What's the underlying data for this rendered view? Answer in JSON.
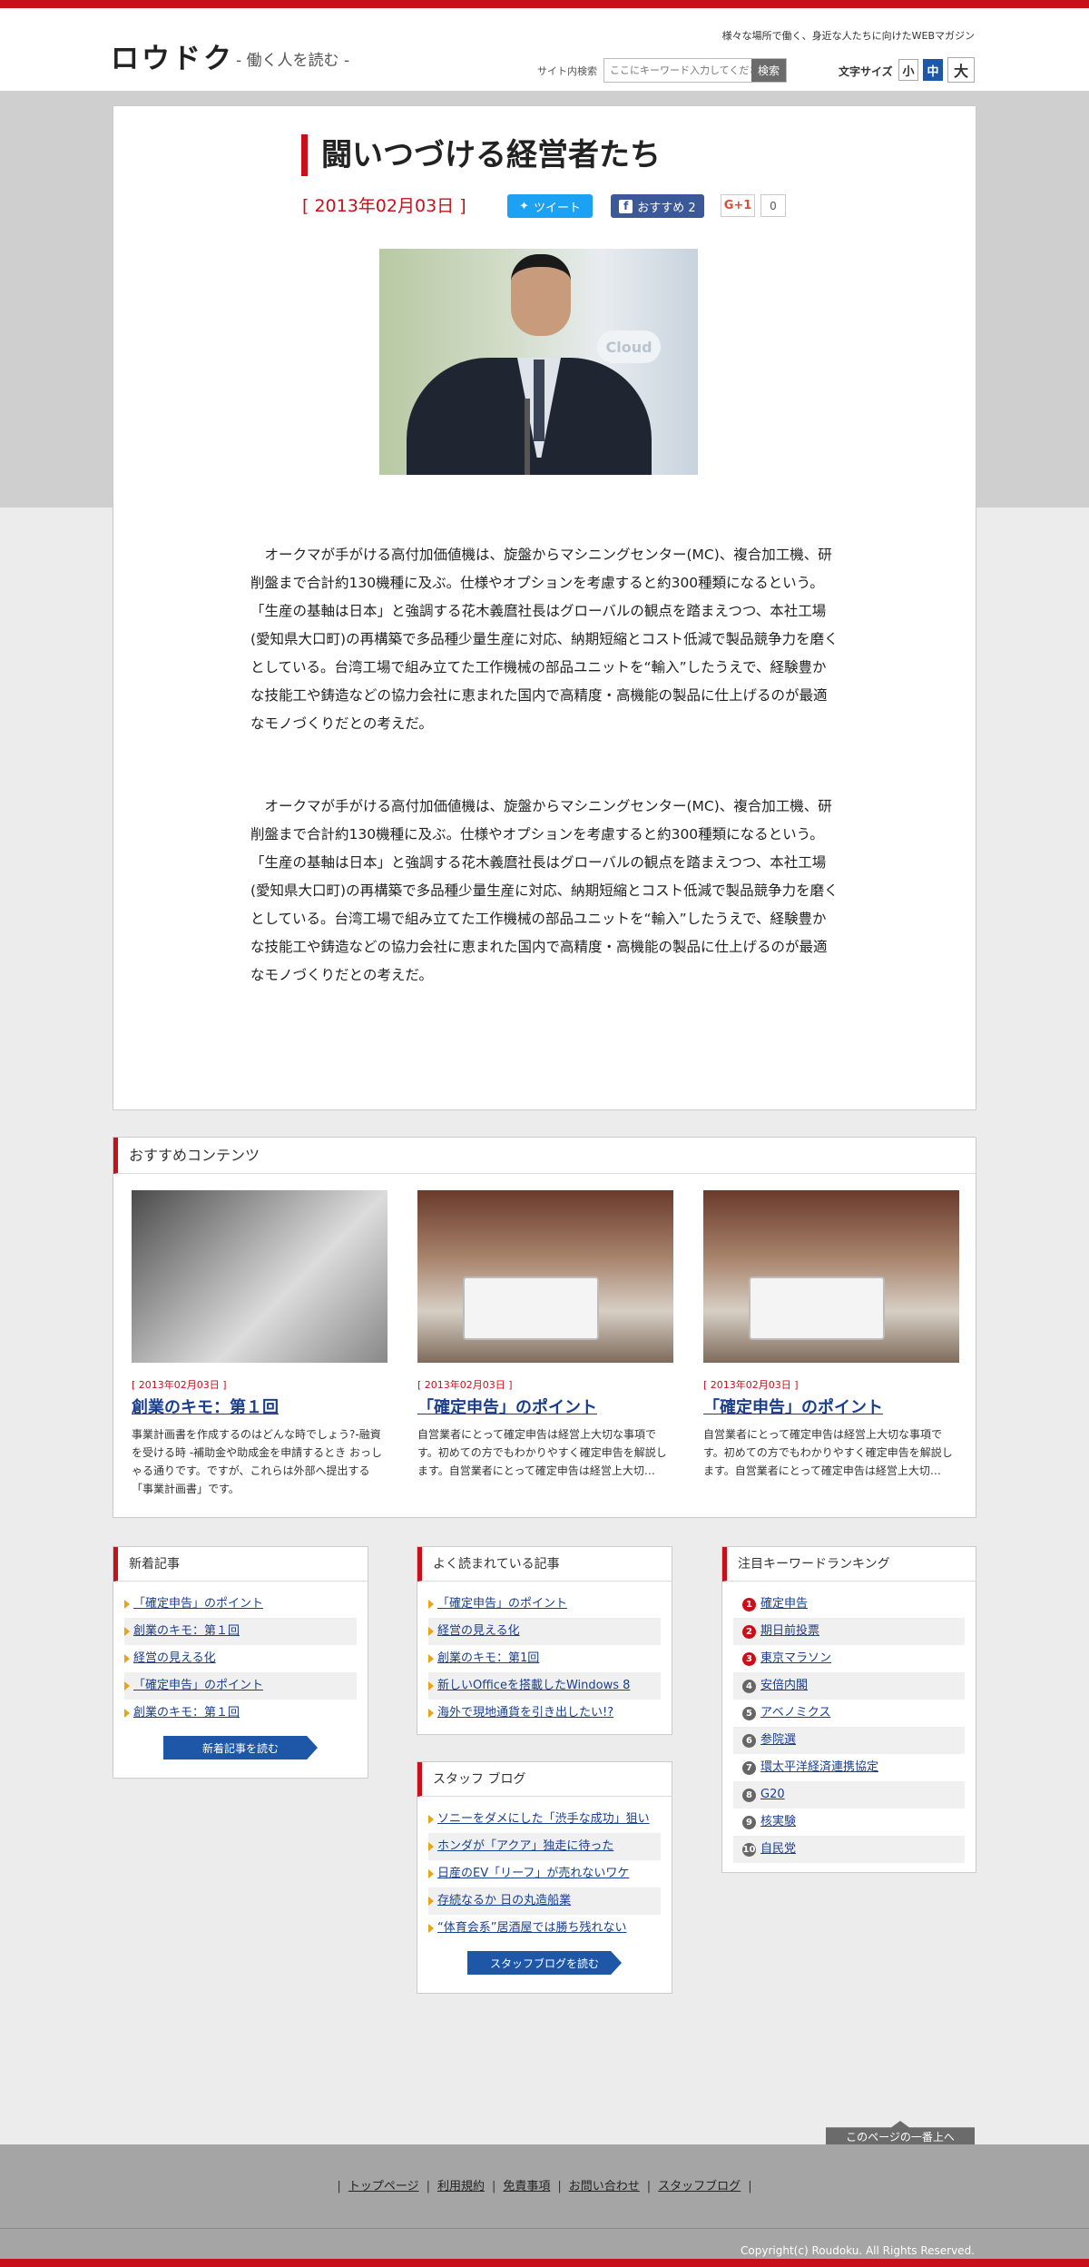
{
  "header": {
    "logo": "ロウドク",
    "logo_sub": "- 働く人を読む -",
    "tagline": "様々な場所で働く、身近な人たちに向けたWEBマガジン",
    "search_label": "サイト内検索",
    "search_placeholder": "ここにキーワード入力してください",
    "search_button": "検索",
    "font_size_label": "文字サイズ",
    "font_small": "小",
    "font_medium": "中",
    "font_large": "大"
  },
  "article": {
    "title": "闘いつづける経営者たち",
    "date": "[ 2013年02月03日 ]",
    "tweet": "ツイート",
    "fb_label": "おすすめ 2",
    "gplus": "G+1",
    "gplus_count": "0",
    "photo_text": "Cloud",
    "paragraphs": [
      "　オークマが手がける高付加価値機は、旋盤からマシニングセンター(MC)、複合加工機、研削盤まで合計約130機種に及ぶ。仕様やオプションを考慮すると約300種類になるという。「生産の基軸は日本」と強調する花木義麿社長はグローバルの観点を踏まえつつ、本社工場(愛知県大口町)の再構築で多品種少量生産に対応、納期短縮とコスト低減で製品競争力を磨くとしている。台湾工場で組み立てた工作機械の部品ユニットを“輸入”したうえで、経験豊かな技能工や鋳造などの協力会社に恵まれた国内で高精度・高機能の製品に仕上げるのが最適なモノづくりだとの考えだ。",
      "　オークマが手がける高付加価値機は、旋盤からマシニングセンター(MC)、複合加工機、研削盤まで合計約130機種に及ぶ。仕様やオプションを考慮すると約300種類になるという。「生産の基軸は日本」と強調する花木義麿社長はグローバルの観点を踏まえつつ、本社工場(愛知県大口町)の再構築で多品種少量生産に対応、納期短縮とコスト低減で製品競争力を磨くとしている。台湾工場で組み立てた工作機械の部品ユニットを“輸入”したうえで、経験豊かな技能工や鋳造などの協力会社に恵まれた国内で高精度・高機能の製品に仕上げるのが最適なモノづくりだとの考えだ。"
    ]
  },
  "recommend": {
    "heading": "おすすめコンテンツ",
    "items": [
      {
        "date": "[ 2013年02月03日 ]",
        "title": "創業のキモ：第１回",
        "desc": "事業計画書を作成するのはどんな時でしょう?-融資を受ける時 -補助金や助成金を申請するとき おっしゃる通りです。ですが、これらは外部へ提出する「事業計画書」です。"
      },
      {
        "date": "[ 2013年02月03日 ]",
        "title": "「確定申告」のポイント",
        "desc": "自営業者にとって確定申告は経営上大切な事項です。初めての方でもわかりやすく確定申告を解説します。自営業者にとって確定申告は経営上大切…"
      },
      {
        "date": "[ 2013年02月03日 ]",
        "title": "「確定申告」のポイント",
        "desc": "自営業者にとって確定申告は経営上大切な事項です。初めての方でもわかりやすく確定申告を解説します。自営業者にとって確定申告は経営上大切…"
      }
    ]
  },
  "new_articles": {
    "heading": "新着記事",
    "items": [
      "「確定申告」のポイント",
      "創業のキモ：第１回",
      "経営の見える化",
      "「確定申告」のポイント",
      "創業のキモ：第１回"
    ],
    "button": "新着記事を読む"
  },
  "popular": {
    "heading": "よく読まれている記事",
    "items": [
      "「確定申告」のポイント",
      "経営の見える化",
      "創業のキモ：第1回",
      "新しいOfficeを搭載したWindows 8",
      "海外で現地通貨を引き出したい!?"
    ]
  },
  "staff_blog": {
    "heading": "スタッフ ブログ",
    "items": [
      "ソニーをダメにした「渋手な成功」狙い",
      "ホンダが「アクア」独走に待った",
      "日産のEV「リーフ」が売れないワケ",
      "存続なるか 日の丸造船業",
      "“体育会系”居酒屋では勝ち残れない"
    ],
    "button": "スタッフブログを読む"
  },
  "ranking": {
    "heading": "注目キーワードランキング",
    "items": [
      "確定申告",
      "期日前投票",
      "東京マラソン",
      "安倍内閣",
      "アベノミクス",
      "参院選",
      "環太平洋経済連携協定",
      "G20",
      "核実験",
      "自民党"
    ],
    "numbers": [
      "1",
      "2",
      "3",
      "4",
      "5",
      "6",
      "7",
      "8",
      "9",
      "10"
    ]
  },
  "footer": {
    "back_to_top": "このページの一番上へ",
    "links": [
      "トップページ",
      "利用規約",
      "免責事項",
      "お問い合わせ",
      "スタッフブログ"
    ],
    "copyright": "Copyright(c) Roudoku. All Rights Reserved."
  },
  "colors": {
    "accent": "#c8101b",
    "link": "#1a3f8f",
    "button_blue": "#1e56a8"
  }
}
